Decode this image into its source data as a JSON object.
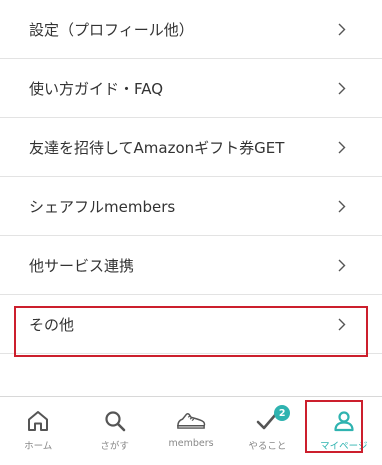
{
  "menu": {
    "items": [
      {
        "label": "設定（プロフィール他）"
      },
      {
        "label": "使い方ガイド・FAQ"
      },
      {
        "label": "友達を招待してAmazonギフト券GET"
      },
      {
        "label": "シェアフルmembers"
      },
      {
        "label": "他サービス連携"
      },
      {
        "label": "その他"
      }
    ],
    "chevron_icon": "chevron-right-icon"
  },
  "tabbar": {
    "tabs": [
      {
        "label": "ホーム",
        "icon": "home-icon"
      },
      {
        "label": "さがす",
        "icon": "search-icon"
      },
      {
        "label": "members",
        "icon": "sneaker-icon"
      },
      {
        "label": "やること",
        "icon": "check-icon",
        "badge": "2"
      },
      {
        "label": "マイページ",
        "icon": "user-icon",
        "active": true
      }
    ]
  },
  "colors": {
    "accent": "#2fb3b0",
    "highlight": "#cc1f2d",
    "text": "#333333",
    "muted": "#888888"
  }
}
